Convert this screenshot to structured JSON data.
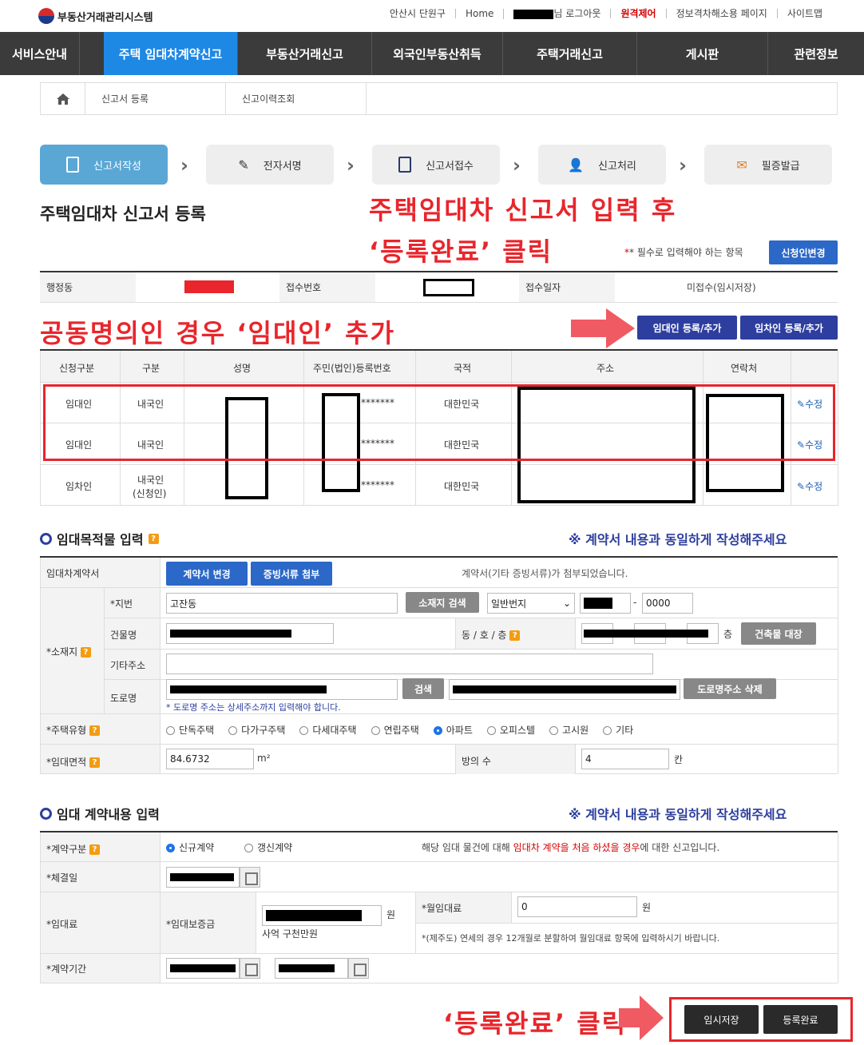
{
  "header": {
    "logo": "부동산거래관리시스템",
    "region": "안산시 단원구",
    "home": "Home",
    "user_suffix": "님 로그아웃",
    "remote": "원격제어",
    "info": "정보격차해소용 페이지",
    "sitemap": "사이트맵"
  },
  "nav": [
    "서비스안내",
    "주택 임대차계약신고",
    "부동산거래신고",
    "외국인부동산취득",
    "주택거래신고",
    "게시판",
    "관련정보"
  ],
  "breadcrumb": {
    "register": "신고서 등록",
    "history": "신고이력조회"
  },
  "steps": [
    "신고서작성",
    "전자서명",
    "신고서접수",
    "신고처리",
    "필증발급"
  ],
  "page_title": "주택임대차 신고서 등록",
  "annotations": {
    "top1": "주택임대차 신고서 입력 후",
    "top2": "‘등록완료’ 클릭",
    "mid": "공동명의인 경우 ‘임대인’ 추가",
    "bottom": "‘등록완료’ 클릭"
  },
  "required_note": "* 필수로 입력해야 하는 항목",
  "applicant_change": "신청인변경",
  "info_row": {
    "dong_label": "행정동",
    "receipt_no_label": "접수번호",
    "receipt_date_label": "접수일자",
    "receipt_date_value": "미접수(임시저장)"
  },
  "buttons": {
    "add_lessor": "임대인 등록/추가",
    "add_lessee": "임차인 등록/추가",
    "change_contract": "계약서 변경",
    "attach_docs": "증빙서류 첨부",
    "search_location": "소재지 검색",
    "building_ledger": "건축물 대장",
    "search": "검색",
    "delete_road": "도로명주소 삭제",
    "temp_save": "임시저장",
    "complete": "등록완료"
  },
  "party_headers": [
    "신청구분",
    "구분",
    "성명",
    "주민(법인)등록번호",
    "국적",
    "주소",
    "연락처"
  ],
  "parties": [
    {
      "type": "임대인",
      "kind": "내국인",
      "id": "*******",
      "nation": "대한민국",
      "edit": "수정"
    },
    {
      "type": "임대인",
      "kind": "내국인",
      "id": "*******",
      "nation": "대한민국",
      "edit": "수정"
    },
    {
      "type": "임차인",
      "kind": "내국인",
      "kind2": "(신청인)",
      "id": "*******",
      "nation": "대한민국",
      "edit": "수정"
    }
  ],
  "section1": {
    "title": "임대목적물 입력",
    "note": "※ 계약서 내용과 동일하게 작성해주세요"
  },
  "property": {
    "contract_label": "임대차계약서",
    "attached_msg": "계약서(기타 증빙서류)가 첨부되었습니다.",
    "location_label": "*소재지",
    "jibun_label": "*지번",
    "jibun_value": "고잔동",
    "lot_type": "일반번지",
    "lot_sub": "0000",
    "building_label": "건물명",
    "dong_ho_label": "동 / 호 / 층",
    "floor_unit": "층",
    "extra_label": "기타주소",
    "road_label": "도로명",
    "road_note": "* 도로명 주소는 상세주소까지 입력해야 합니다.",
    "housing_label": "*주택유형",
    "housing_types": [
      "단독주택",
      "다가구주택",
      "다세대주택",
      "연립주택",
      "아파트",
      "오피스텔",
      "고시원",
      "기타"
    ],
    "housing_selected": "아파트",
    "area_label": "*임대면적",
    "area_value": "84.6732",
    "area_unit": "m²",
    "rooms_label": "방의 수",
    "rooms_value": "4",
    "rooms_unit": "칸"
  },
  "section2": {
    "title": "임대 계약내용 입력",
    "note": "※ 계약서 내용과 동일하게 작성해주세요"
  },
  "contract": {
    "type_label": "*계약구분",
    "new": "신규계약",
    "renew": "갱신계약",
    "desc_pre": "해당 임대 물건에 대해 ",
    "desc_red": "임대차 계약을 처음 하셨을 경우",
    "desc_post": "에 대한 신고입니다.",
    "date_label": "*체결일",
    "rent_label": "*임대료",
    "deposit_label": "*임대보증금",
    "won": "원",
    "deposit_words": "사억 구천만원",
    "monthly_label": "*월임대료",
    "monthly_value": "0",
    "jeju_note": "*(제주도) 연세의 경우 12개월로 분할하여 월임대료 항목에 입력하시기 바랍니다.",
    "period_label": "*계약기간"
  },
  "colors": {
    "nav_bg": "#3b3b3b",
    "nav_active": "#1e88e5",
    "annotation": "#e8262c",
    "navy": "#2d3e9e"
  }
}
